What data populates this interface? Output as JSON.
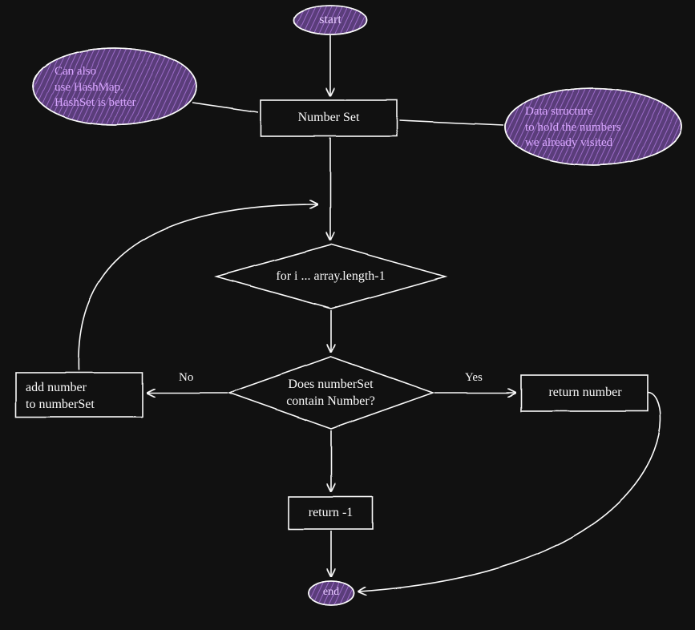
{
  "start": {
    "label": "start"
  },
  "callout_left": {
    "line1": "Can also",
    "line2": "use HashMap.",
    "line3": "HashSet is better"
  },
  "callout_right": {
    "line1": "Data structure",
    "line2": "to hold the numbers",
    "line3": "we already visited"
  },
  "number_set": {
    "label": "Number Set"
  },
  "loop": {
    "label": "for i ... array.length-1"
  },
  "decision": {
    "line1": "Does numberSet",
    "line2": "contain Number?"
  },
  "add_number": {
    "line1": "add number",
    "line2": "to numberSet"
  },
  "return_number": {
    "label": "return number"
  },
  "return_neg1": {
    "label": "return -1"
  },
  "end": {
    "label": "end"
  },
  "edges": {
    "no": "No",
    "yes": "Yes"
  },
  "colors": {
    "fg": "#fafafa",
    "fill": "#5a3d7a",
    "hatch": "#9b6bc7",
    "calloutText": "#d9a7ff"
  }
}
